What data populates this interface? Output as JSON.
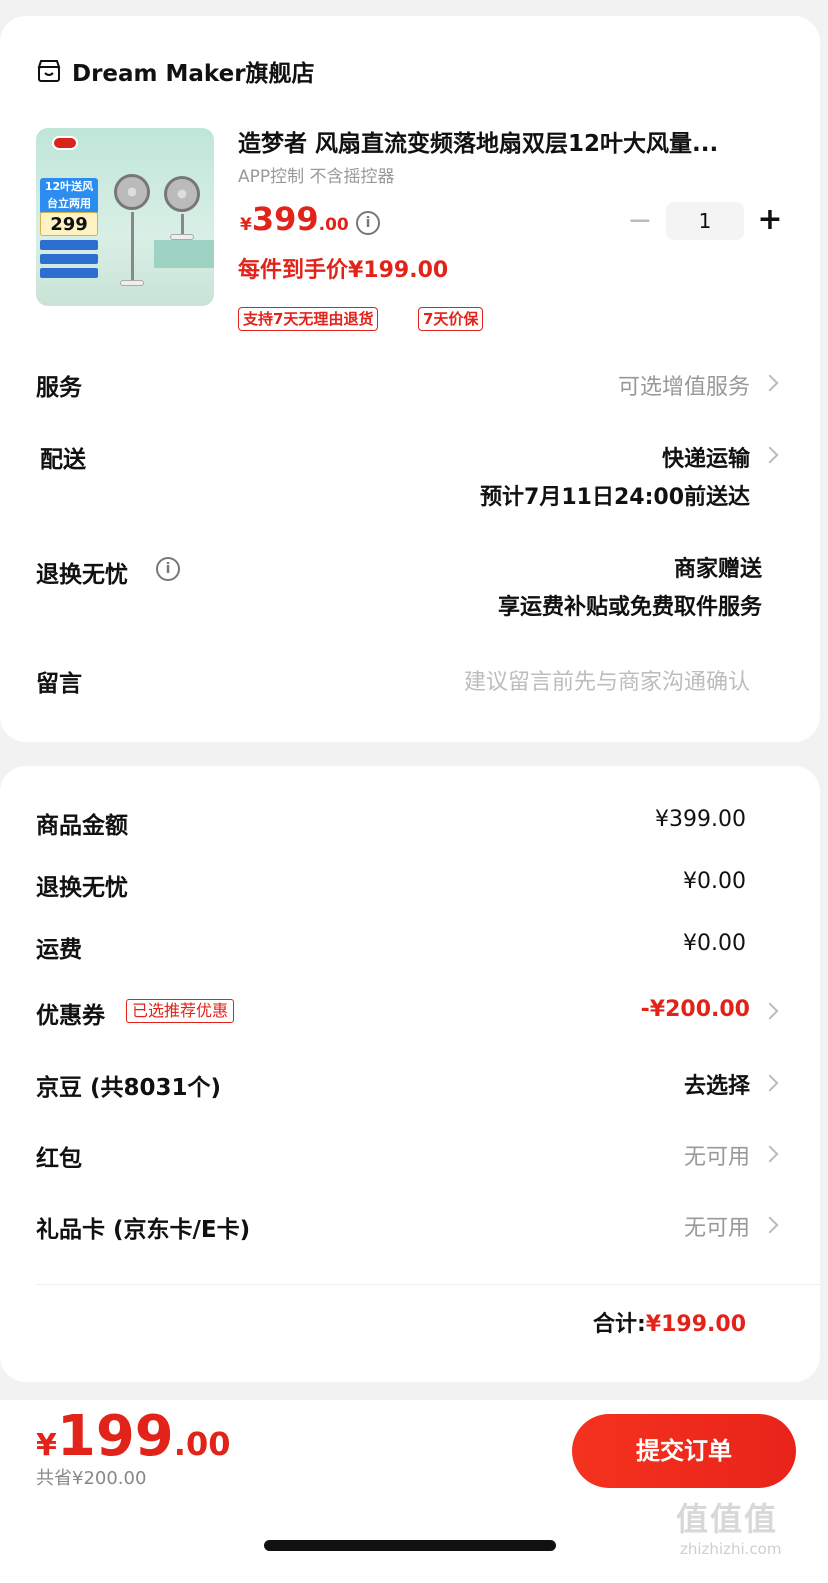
{
  "shop": {
    "name": "Dream Maker旗舰店",
    "icon": "shop-icon"
  },
  "product": {
    "title": "造梦者 风扇直流变频落地扇双层12叶大风量...",
    "spec": "APP控制 不含摇控器",
    "price_yen": "¥",
    "price_int": "399",
    "price_dec": ".00",
    "final_price": "每件到手价¥199.00",
    "tags": [
      "支持7天无理由退货",
      "7天价保"
    ],
    "image_text": {
      "blue_tag": "12叶送风 台立两用",
      "price": "299"
    }
  },
  "quantity": {
    "minus": "−",
    "value": "1",
    "plus": "+"
  },
  "rows": {
    "service": {
      "label": "服务",
      "value": "可选增值服务"
    },
    "delivery": {
      "label": "配送",
      "value": "快递运输",
      "sub": "预计7月11日24:00前送达"
    },
    "return": {
      "label": "退换无忧",
      "value": "商家赠送",
      "sub": "享运费补贴或免费取件服务"
    },
    "message": {
      "label": "留言",
      "placeholder": "建议留言前先与商家沟通确认"
    }
  },
  "summary": {
    "goods": {
      "label": "商品金额",
      "value": "¥399.00"
    },
    "return": {
      "label": "退换无忧",
      "value": "¥0.00"
    },
    "shipping": {
      "label": "运费",
      "value": "¥0.00"
    },
    "coupon": {
      "label": "优惠券",
      "tag": "已选推荐优惠",
      "value": "-¥200.00"
    },
    "jingdou": {
      "label": "京豆 (共8031个)",
      "value": "去选择"
    },
    "redpacket": {
      "label": "红包",
      "value": "无可用"
    },
    "giftcard": {
      "label": "礼品卡 (京东卡/E卡)",
      "value": "无可用"
    },
    "total_label": "合计:",
    "total_value": "¥199.00"
  },
  "footer": {
    "yen": "¥",
    "int": "199",
    "dec": ".00",
    "saved": "共省¥200.00",
    "submit": "提交订单"
  },
  "watermark": {
    "logo": "值值值",
    "site": "zhizhizhi.com"
  },
  "colors": {
    "accent": "#e2231a",
    "muted": "#999999"
  }
}
